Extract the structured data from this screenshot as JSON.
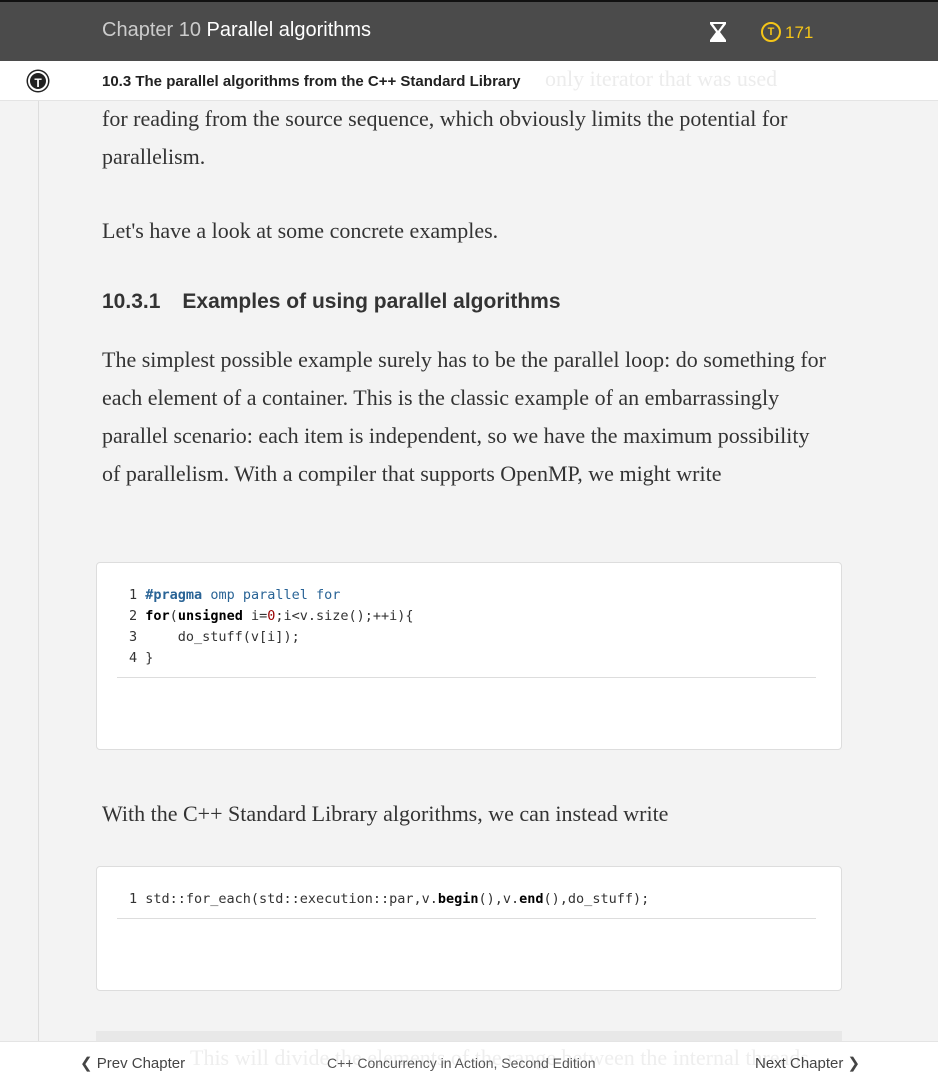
{
  "header": {
    "chapter_prefix": "Chapter 10",
    "chapter_title": "Parallel algorithms",
    "token_count": "171",
    "coin_glyph": "T"
  },
  "subheader": {
    "section": "10.3  The parallel algorithms from the C++ Standard Library",
    "ghost_text": "only iterator that was used",
    "icon_glyph": "T"
  },
  "content": {
    "para1_tail": "for reading from the source sequence, which obviously limits the potential for parallelism.",
    "para2": "Let's have a look at some concrete examples.",
    "heading_num": "10.3.1",
    "heading_text": "Examples of using parallel algorithms",
    "para3": "The simplest possible example surely has to be the parallel loop: do something for each element of a container. This is the classic example of an embarrassingly parallel scenario: each item is independent, so we have the maximum possibility of parallelism. With a compiler that supports OpenMP, we might write",
    "code1": [
      {
        "n": "1",
        "a": "#",
        "pp": "pragma",
        "b": " omp parallel for"
      },
      {
        "n": "2"
      },
      {
        "n": "3",
        "t": "     do_stuff(v[i]);"
      },
      {
        "n": "4",
        "t": " }"
      }
    ],
    "para4": "With the C++ Standard Library algorithms, we can instead write",
    "code2_line": "1"
  },
  "footer": {
    "prev": "Prev Chapter",
    "title": "C++ Concurrency in Action, Second Edition",
    "next": "Next Chapter",
    "ghost_text": "This will divide the elements of the range between the internal threads"
  }
}
